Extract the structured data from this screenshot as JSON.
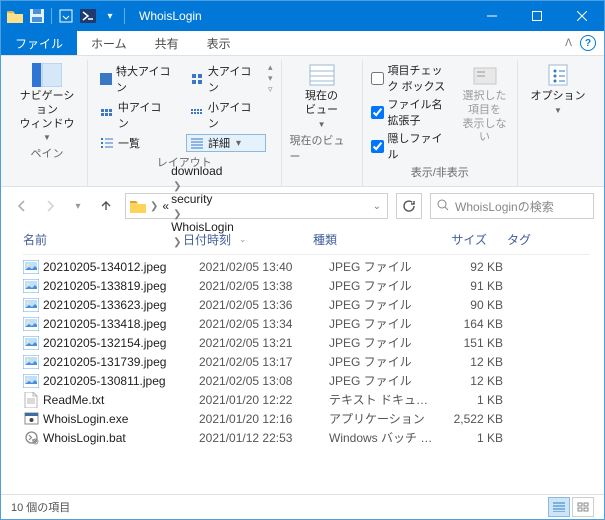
{
  "window": {
    "title": "WhoisLogin"
  },
  "tabs": {
    "file": "ファイル",
    "home": "ホーム",
    "share": "共有",
    "view": "表示"
  },
  "ribbon": {
    "panes": {
      "nav": "ナビゲーション\nウィンドウ",
      "group": "ペイン"
    },
    "layout": {
      "xl": "特大アイコン",
      "l": "大アイコン",
      "m": "中アイコン",
      "s": "小アイコン",
      "list": "一覧",
      "details": "詳細",
      "group": "レイアウト"
    },
    "current_view": {
      "btn": "現在の\nビュー",
      "group": "現在のビュー"
    },
    "showhide": {
      "checkboxes": "項目チェック ボックス",
      "ext": "ファイル名拡張子",
      "hidden": "隠しファイル",
      "hide_selected": "選択した項目を\n表示しない",
      "group": "表示/非表示"
    },
    "options": {
      "btn": "オプション"
    }
  },
  "breadcrumbs": {
    "items": [
      "download",
      "security",
      "WhoisLogin"
    ]
  },
  "search": {
    "placeholder": "WhoisLoginの検索"
  },
  "columns": {
    "name": "名前",
    "date": "日付時刻",
    "kind": "種類",
    "size": "サイズ",
    "tag": "タグ"
  },
  "files": [
    {
      "icon": "img",
      "name": "20210205-134012.jpeg",
      "date": "2021/02/05 13:40",
      "kind": "JPEG ファイル",
      "size": "92 KB"
    },
    {
      "icon": "img",
      "name": "20210205-133819.jpeg",
      "date": "2021/02/05 13:38",
      "kind": "JPEG ファイル",
      "size": "91 KB"
    },
    {
      "icon": "img",
      "name": "20210205-133623.jpeg",
      "date": "2021/02/05 13:36",
      "kind": "JPEG ファイル",
      "size": "90 KB"
    },
    {
      "icon": "img",
      "name": "20210205-133418.jpeg",
      "date": "2021/02/05 13:34",
      "kind": "JPEG ファイル",
      "size": "164 KB"
    },
    {
      "icon": "img",
      "name": "20210205-132154.jpeg",
      "date": "2021/02/05 13:21",
      "kind": "JPEG ファイル",
      "size": "151 KB"
    },
    {
      "icon": "img",
      "name": "20210205-131739.jpeg",
      "date": "2021/02/05 13:17",
      "kind": "JPEG ファイル",
      "size": "12 KB"
    },
    {
      "icon": "img",
      "name": "20210205-130811.jpeg",
      "date": "2021/02/05 13:08",
      "kind": "JPEG ファイル",
      "size": "12 KB"
    },
    {
      "icon": "txt",
      "name": "ReadMe.txt",
      "date": "2021/01/20 12:22",
      "kind": "テキスト ドキュメント",
      "size": "1 KB"
    },
    {
      "icon": "exe",
      "name": "WhoisLogin.exe",
      "date": "2021/01/20 12:16",
      "kind": "アプリケーション",
      "size": "2,522 KB"
    },
    {
      "icon": "bat",
      "name": "WhoisLogin.bat",
      "date": "2021/01/12 22:53",
      "kind": "Windows バッチ ファ...",
      "size": "1 KB"
    }
  ],
  "status": {
    "count": "10 個の項目"
  }
}
